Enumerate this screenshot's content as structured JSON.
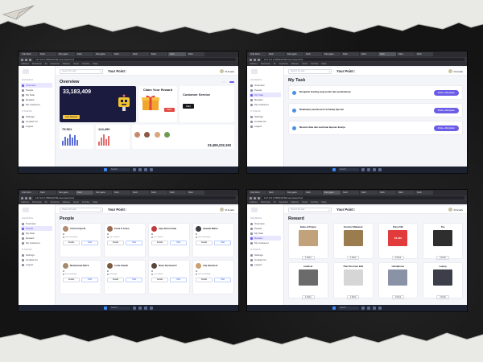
{
  "colors": {
    "accent": "#6b5ce7",
    "dark_card": "#1b1a3f",
    "page_bg": "#141414"
  },
  "browser": {
    "tabs": [
      "ICE Mob",
      "Mob",
      "Mongala",
      "Mob",
      "Mongala",
      "Mob",
      "Mob",
      "Mob",
      "Mob",
      "Mob"
    ],
    "url": "127.0.0.1:5500/HTML/overview.html",
    "bookmarks": [
      "Indihome",
      "Buat Anak",
      "Fb",
      "Facebook",
      "Malware",
      "Gmail",
      "YouTube",
      "Maps",
      "Translate",
      "Berita",
      "Dicoding Academy"
    ]
  },
  "sidebar": {
    "section_general": "GENERAL",
    "items": [
      "Overview",
      "People",
      "My Task",
      "Reward",
      "My Customer"
    ],
    "section_others": "OTHERS",
    "others": [
      "Settings",
      "Contact Us",
      "Logout"
    ]
  },
  "topbar": {
    "search_placeholder": "Search for task",
    "point_label": "Your Point :",
    "user_name": "M Arsalis"
  },
  "taskbar": {
    "left": "",
    "clock": "",
    "search": "Search"
  },
  "overview": {
    "title": "Overview",
    "subtitle": "",
    "date_label": "",
    "header_button": "",
    "balance": "33,183,409",
    "balance_sub": "",
    "balance_button": "Your Reward",
    "claim_title": "Claim Your Reward",
    "claim_button": "Claim",
    "cs_title": "Customer Service",
    "cs_button": "Start",
    "mini1_value": "75.561",
    "mini2_value": "124,490",
    "big_number": "23,409,232,193"
  },
  "tasks": {
    "title": "My Task",
    "subtitle": "",
    "items": [
      {
        "title": "Mengikuti briefing yang terdiri dari pembahasan",
        "meta1": "",
        "meta2": "",
        "meta3": "",
        "button": "Mulai ▸ Dikerjakan"
      },
      {
        "title": "Melakukan penelusuran terhadap laporan",
        "meta1": "",
        "meta2": "",
        "meta3": "",
        "button": "Mulai ▸ Dikerjakan"
      },
      {
        "title": "Mencari data dan membuat laporan kinerja",
        "meta1": "",
        "meta2": "",
        "meta3": "",
        "button": "Mulai ▸ Dikerjakan"
      }
    ]
  },
  "people": {
    "title": "People",
    "list": [
      {
        "name": "I Putu Ardya W.",
        "role": "",
        "loc": "Kota Semarang",
        "btn1": "Details",
        "btn2": "Chat"
      },
      {
        "name": "Fenni P. Arnen",
        "role": "",
        "loc": "Kab. Jakarta",
        "btn1": "Details",
        "btn2": "Chat"
      },
      {
        "name": "Jaya Putra Anwar",
        "role": "",
        "loc": "DKI Jakarta",
        "btn1": "Details",
        "btn2": "Chat"
      },
      {
        "name": "Jarwadi Mahar",
        "role": "",
        "loc": "Kota Semarang",
        "btn1": "Details",
        "btn2": "Chat"
      },
      {
        "name": "Muhammad Rafi S.",
        "role": "",
        "loc": "Kota Bandung",
        "btn1": "Details",
        "btn2": "Chat"
      },
      {
        "name": "Listia Ghaniti",
        "role": "",
        "loc": "Surabaya",
        "btn1": "Details",
        "btn2": "Chat"
      },
      {
        "name": "Ilham Rusmana P.",
        "role": "",
        "loc": "DKI Jakarta",
        "btn1": "Details",
        "btn2": "Chat"
      },
      {
        "name": "Alfy Octavia K.",
        "role": "",
        "loc": "Kota Semarang",
        "btn1": "Details",
        "btn2": "Chat"
      }
    ]
  },
  "reward": {
    "title": "Reward",
    "items": [
      {
        "name": "Buku & Pulpen",
        "img_label": "",
        "img_color": "#c2a27a",
        "button": "1 Point"
      },
      {
        "name": "Voucher Makanan",
        "img_label": "",
        "img_color": "#9b7c4e",
        "button": "1 Point"
      },
      {
        "name": "Pulsa 50k",
        "img_label": "50.000",
        "img_color": "#e23b3b",
        "button": "1 Point"
      },
      {
        "name": "Tas",
        "img_label": "",
        "img_color": "#2e2e2e",
        "button": "1 Point"
      },
      {
        "name": "Headset",
        "img_label": "",
        "img_color": "#6b6b6b",
        "button": "1 Point"
      },
      {
        "name": "Thai Perormer Ball",
        "img_label": "",
        "img_color": "#d6d6d6",
        "button": "1 Point"
      },
      {
        "name": "Handphone",
        "img_label": "",
        "img_color": "#8a93a6",
        "button": "1 Point"
      },
      {
        "name": "Laptop",
        "img_label": "",
        "img_color": "#3c3f4a",
        "button": "1 Point"
      }
    ]
  }
}
